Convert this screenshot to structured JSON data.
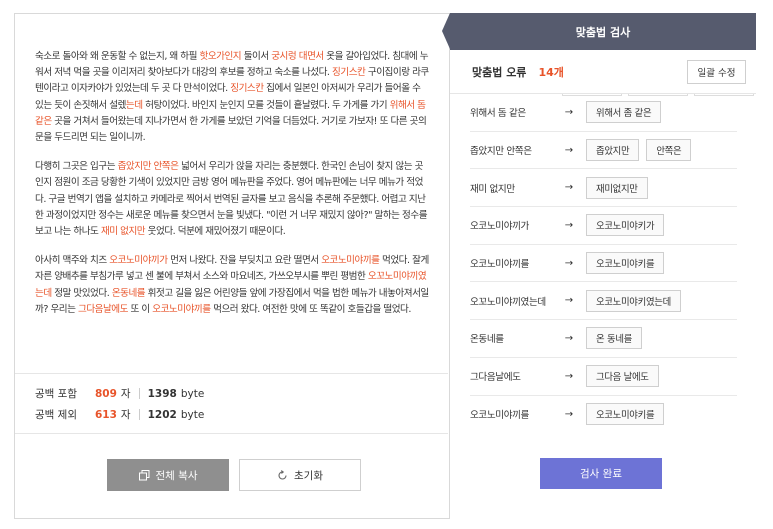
{
  "editor": {
    "paragraphs": [
      [
        {
          "t": "숙소로 돌아와 왜 운동할 수 없는지, 왜 하필 "
        },
        {
          "t": "핫오가인지",
          "e": true
        },
        {
          "t": " 둘이서 "
        },
        {
          "t": "궁시렁 대면서",
          "e": true
        },
        {
          "t": " 옷을 갈아입었다. 침대에 누워서 저녁 먹을 곳을 이리저리 찾아보다가 대강의 후보를 정하고 숙소를 나섰다. "
        },
        {
          "t": "징기스칸",
          "e": true
        },
        {
          "t": " 구이집이랑 라쿠텐이라고 이자카야가 있었는데 두 곳 다 만석이었다. "
        },
        {
          "t": "징기스칸",
          "e": true
        },
        {
          "t": " 집에서 일본인 아저씨가 우리가 들어올 수 있는 듯이 손짓해서 설렜"
        },
        {
          "t": "는데",
          "e": true
        },
        {
          "t": " 허탕이었다. 바인지 눈인지 모를 것들이 흩날렸다. 두 가게를 가기 "
        },
        {
          "t": "위해서 돔 같은",
          "e": true
        },
        {
          "t": " 곳을 거쳐서 들어왔는데 지나가면서 한 가게를 보았던 기억을 더듬었다. 거기로 가보자! 또 다른 곳의 문을 두드리면 되는 일이니까."
        }
      ],
      [
        {
          "t": "다행히 그곳은 입구는 "
        },
        {
          "t": "좁았지만 안쪽은",
          "e": true
        },
        {
          "t": " 넓어서 우리가 앉을 자리는 충분했다. 한국인 손님이 찾지 않는 곳인지 점원이 조금 당황한 기색이 있었지만 금방 영어 메뉴판을 주었다. 영어 메뉴판에는 너무 메뉴가 적었다. 구글 번역기 앱을 설치하고 카메라로 찍어서 번역된 글자를 보고 음식을 추론해 주문했다. 어렵고 지난한 과정이었지만 정수는 새로운 메뉴를 찾으면서 눈을 빛냈다. \"이런 거 너무 재밌지 않아?\" 말하는 정수를 보고 나는 하나도 "
        },
        {
          "t": "재미 없지만",
          "e": true
        },
        {
          "t": " 웃었다. 덕분에 재밌어졌기 때문이다."
        }
      ],
      [
        {
          "t": "아사히 맥주와 치즈 "
        },
        {
          "t": "오코노미야끼가",
          "e": true
        },
        {
          "t": " 먼저 나왔다. 잔을 부딪치고 요란 떨면서 "
        },
        {
          "t": "오코노미야끼를",
          "e": true
        },
        {
          "t": " 먹었다. 잘게 자른 양배추를 부침가루 넣고 센 불에 부쳐서 소스와 마요네즈, 가쓰오부시를 뿌린 평범한 "
        },
        {
          "t": "오꼬노미야끼였는데",
          "e": true
        },
        {
          "t": " 정말 맛있었다. "
        },
        {
          "t": "온동네를",
          "e": true
        },
        {
          "t": " 휘젓고 길을 잃은 어린양들 앞에 가장집에서 먹을 법한 메뉴가 내놓아져서일까? 우리는 "
        },
        {
          "t": "그다음날에도",
          "e": true
        },
        {
          "t": " 또 이 "
        },
        {
          "t": "오코노미야끼를",
          "e": true
        },
        {
          "t": " 먹으러 왔다. 여전한 맛에 또 똑같이 호들갑을 떨었다."
        }
      ]
    ]
  },
  "counts": {
    "with_space_label": "공백 포함",
    "with_space_chars": "809",
    "with_space_bytes": "1398",
    "without_space_label": "공백 제외",
    "without_space_chars": "613",
    "without_space_bytes": "1202",
    "char_unit": "자",
    "byte_unit": "byte"
  },
  "buttons": {
    "copy_all": "전체 복사",
    "reset": "초기화"
  },
  "panel": {
    "title": "맞춤법 검사",
    "error_label": "맞춤법 오류",
    "error_count": "14개",
    "fix_all": "일괄 수정",
    "arrow": "→",
    "corrections": [
      {
        "original": "위해서 돔 같은",
        "suggestions": [
          "위해서 좀 같은"
        ]
      },
      {
        "original": "좁았지만 안쪽은",
        "suggestions": [
          "좁았지만",
          "안쪽은"
        ]
      },
      {
        "original": "재미 없지만",
        "suggestions": [
          "재미없지만"
        ]
      },
      {
        "original": "오코노미야끼가",
        "suggestions": [
          "오코노미야키가"
        ]
      },
      {
        "original": "오코노미야끼를",
        "suggestions": [
          "오코노미야키를"
        ]
      },
      {
        "original": "오꼬노미야끼였는데",
        "suggestions": [
          "오코노미야키였는데"
        ]
      },
      {
        "original": "온동네를",
        "suggestions": [
          "온 동네를"
        ]
      },
      {
        "original": "그다음날에도",
        "suggestions": [
          "그다음 날에도"
        ]
      },
      {
        "original": "오코노미야끼를",
        "suggestions": [
          "오코노미야키를"
        ]
      }
    ],
    "done": "검사 완료"
  }
}
